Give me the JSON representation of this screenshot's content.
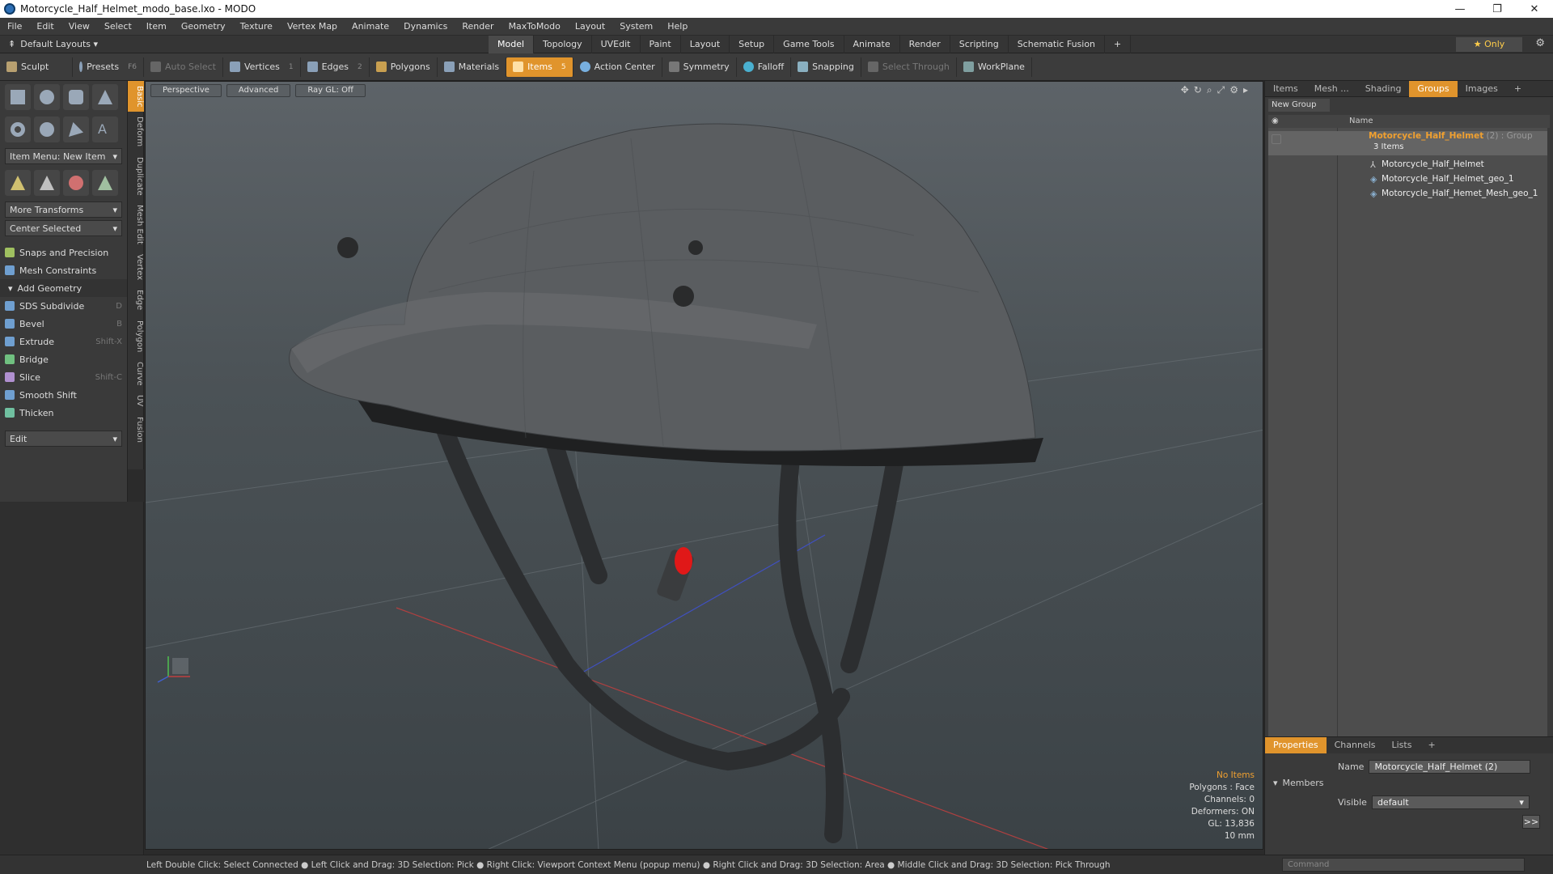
{
  "window": {
    "title": "Motorcycle_Half_Helmet_modo_base.lxo - MODO",
    "min": "—",
    "max": "❐",
    "close": "✕"
  },
  "menu": [
    "File",
    "Edit",
    "View",
    "Select",
    "Item",
    "Geometry",
    "Texture",
    "Vertex Map",
    "Animate",
    "Dynamics",
    "Render",
    "MaxToModo",
    "Layout",
    "System",
    "Help"
  ],
  "layoutbar": {
    "default_layouts": "Default Layouts ▾",
    "tabs": [
      "Model",
      "Topology",
      "UVEdit",
      "Paint",
      "Layout",
      "Setup",
      "Game Tools",
      "Animate",
      "Render",
      "Scripting",
      "Schematic Fusion",
      "+"
    ],
    "active_tab": "Model",
    "only": "★  Only",
    "gear": "⚙"
  },
  "toolbar": {
    "sculpt": "Sculpt",
    "presets": "Presets",
    "presets_key": "F6",
    "auto_select": "Auto Select",
    "vertices": "Vertices",
    "vertices_n": "1",
    "edges": "Edges",
    "edges_n": "2",
    "polygons": "Polygons",
    "materials": "Materials",
    "items": "Items",
    "items_n": "5",
    "action_center": "Action Center",
    "symmetry": "Symmetry",
    "falloff": "Falloff",
    "snapping": "Snapping",
    "select_through": "Select Through",
    "workplane": "WorkPlane"
  },
  "left": {
    "item_menu": "Item Menu: New Item",
    "more_transforms": "More Transforms",
    "center_selected": "Center Selected",
    "snaps": "Snaps and Precision",
    "mesh_constraints": "Mesh Constraints",
    "add_geometry": "Add Geometry",
    "tools": [
      {
        "label": "SDS Subdivide",
        "key": "D"
      },
      {
        "label": "Bevel",
        "key": "B"
      },
      {
        "label": "Extrude",
        "key": "Shift-X"
      },
      {
        "label": "Bridge",
        "key": ""
      },
      {
        "label": "Slice",
        "key": "Shift-C"
      },
      {
        "label": "Smooth Shift",
        "key": ""
      },
      {
        "label": "Thicken",
        "key": ""
      }
    ],
    "edit": "Edit",
    "vtabs": [
      "Basic",
      "Deform",
      "Duplicate",
      "Mesh Edit",
      "Vertex",
      "Edge",
      "Polygon",
      "Curve",
      "UV",
      "Fusion"
    ]
  },
  "viewport": {
    "perspective": "Perspective",
    "advanced": "Advanced",
    "raygl": "Ray GL: Off",
    "info": {
      "items": "No Items",
      "polygons": "Polygons : Face",
      "channels": "Channels: 0",
      "deformers": "Deformers: ON",
      "gl": "GL: 13,836",
      "scale": "10 mm"
    }
  },
  "right": {
    "tabs": [
      "Items",
      "Mesh ...",
      "Shading",
      "Groups",
      "Images",
      "+"
    ],
    "active_tab": "Groups",
    "new_group": "New Group",
    "col_name": "Name",
    "group_name": "Motorcycle_Half_Helmet",
    "group_suffix": " (2) : Group",
    "group_count": "3 Items",
    "children": [
      "Motorcycle_Half_Helmet",
      "Motorcycle_Half_Helmet_geo_1",
      "Motorcycle_Half_Hemet_Mesh_geo_1"
    ]
  },
  "properties": {
    "tabs": [
      "Properties",
      "Channels",
      "Lists",
      "+"
    ],
    "active_tab": "Properties",
    "name_label": "Name",
    "name_value": "Motorcycle_Half_Helmet (2)",
    "members": "Members",
    "visible_label": "Visible",
    "visible_value": "default",
    "more": ">>"
  },
  "status": {
    "text": "Left Double Click: Select Connected ● Left Click and Drag: 3D Selection: Pick ● Right Click: Viewport Context Menu (popup menu) ● Right Click and Drag: 3D Selection: Area ● Middle Click and Drag: 3D Selection: Pick Through",
    "command_placeholder": "Command"
  }
}
